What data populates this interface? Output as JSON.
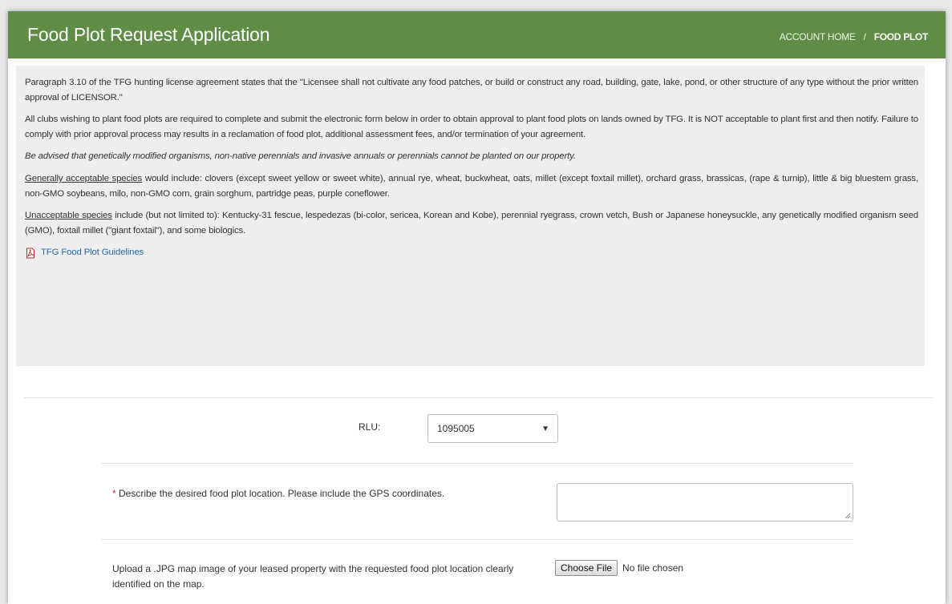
{
  "header": {
    "title": "Food Plot Request Application",
    "breadcrumb": {
      "home": "ACCOUNT HOME",
      "separator": "/",
      "current": "FOOD PLOT"
    }
  },
  "info": {
    "p1": "Paragraph 3.10 of the TFG hunting license agreement states that the \"Licensee shall not cultivate any food patches, or build or construct any road, building, gate, lake, pond, or other structure of any type without the prior written approval of LICENSOR.\"",
    "p2": "All clubs wishing to plant food plots are required to complete and submit the electronic form below in order to obtain approval to plant food plots on lands owned by TFG. It is NOT acceptable to plant first and then notify. Failure to comply with prior approval process may results in a reclamation of food plot, additional assessment fees, and/or termination of your agreement.",
    "p3": "Be advised that genetically modified organisms, non-native perennials and invasive annuals or perennials cannot be planted on our property.",
    "p4_label": "Generally acceptable species",
    "p4_text": " would include: clovers (except sweet yellow or sweet white), annual rye, wheat, buckwheat, oats, millet (except foxtail millet), orchard grass, brassicas, (rape & turnip), little & big bluestem grass, non-GMO soybeans, milo, non-GMO corn, grain sorghum, partridge peas, purple coneflower.",
    "p5_label": "Unacceptable species",
    "p5_text": " include (but not limited to): Kentucky-31 fescue, lespedezas (bi-color, sericea, Korean and Kobe), perennial ryegrass, crown vetch, Bush or Japanese honeysuckle, any genetically modified organism seed (GMO), foxtail millet (\"giant foxtail\"), and some biologics.",
    "guidelines_link": "TFG Food Plot Guidelines"
  },
  "form": {
    "rlu_label": "RLU:",
    "rlu_value": "1095005",
    "location_required_mark": "*",
    "location_label": " Describe the desired food plot location. Please include the GPS coordinates.",
    "location_value": "",
    "upload_label": "Upload a .JPG map image of your leased property with the requested food plot location clearly identified on the map.",
    "choose_file_label": "Choose File",
    "no_file_text": "No file chosen"
  },
  "colors": {
    "header_green": "#5f8d46",
    "info_background": "#eeeeee",
    "link_blue": "#2a6aa8",
    "required_red": "#d0312d"
  }
}
